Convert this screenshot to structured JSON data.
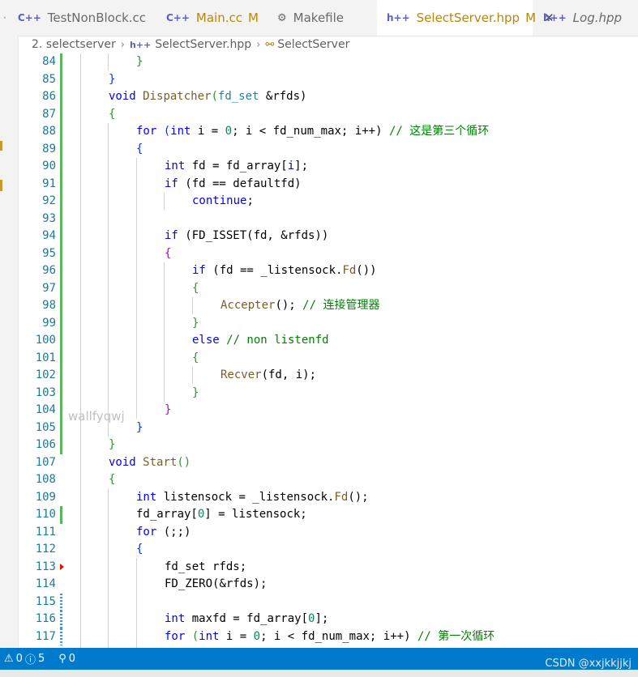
{
  "tabs": [
    {
      "label": "TestNonBlock.cc",
      "icon": "C++",
      "modified": "",
      "active": false
    },
    {
      "label": "Main.cc",
      "icon": "C++",
      "modified": "M",
      "active": false
    },
    {
      "label": "Makefile",
      "icon": "makefile-icon",
      "modified": "",
      "active": false
    },
    {
      "label": "SelectServer.hpp",
      "icon": "h++",
      "modified": "M",
      "active": true,
      "close": "✕"
    },
    {
      "label": "Log.hpp",
      "icon": "h++",
      "modified": "",
      "active": false
    }
  ],
  "breadcrumb": {
    "folder": "2. selectserver",
    "file_icon": "h++",
    "file": "SelectServer.hpp",
    "symbol": "SelectServer"
  },
  "editor": {
    "lines": [
      {
        "n": "84"
      },
      {
        "n": "85"
      },
      {
        "n": "86"
      },
      {
        "n": "87"
      },
      {
        "n": "88"
      },
      {
        "n": "89"
      },
      {
        "n": "90"
      },
      {
        "n": "91"
      },
      {
        "n": "92"
      },
      {
        "n": "93"
      },
      {
        "n": "94"
      },
      {
        "n": "95"
      },
      {
        "n": "96"
      },
      {
        "n": "97"
      },
      {
        "n": "98"
      },
      {
        "n": "99"
      },
      {
        "n": "100"
      },
      {
        "n": "101"
      },
      {
        "n": "102"
      },
      {
        "n": "103"
      },
      {
        "n": "104"
      },
      {
        "n": "105"
      },
      {
        "n": "106"
      },
      {
        "n": "107"
      },
      {
        "n": "108"
      },
      {
        "n": "109"
      },
      {
        "n": "110"
      },
      {
        "n": "111"
      },
      {
        "n": "112"
      },
      {
        "n": "113"
      },
      {
        "n": "114"
      },
      {
        "n": "115"
      },
      {
        "n": "116"
      },
      {
        "n": "117"
      }
    ],
    "code": {
      "l84": "}",
      "l85": "}",
      "l86_kw": "void",
      "l86_fn": "Dispatcher",
      "l86_ty": "fd_set",
      "l86_rest": " &rfds)",
      "l87": "{",
      "l88_kw": "for",
      "l88_ty": "int",
      "l88_a": " i = ",
      "l88_num": "0",
      "l88_b": "; i < fd_num_max; i++) ",
      "l88_cm": "// 这是第三个循环",
      "l89": "{",
      "l90_ty": "int",
      "l90_a": " fd = fd_array[",
      "l90_b": "i",
      "l90_c": "];",
      "l91_kw": "if",
      "l91_a": " (fd == defaultfd)",
      "l92_kw": "continue",
      "l94_kw": "if",
      "l94_a": " (FD_ISSET(fd, &rfds))",
      "l95": "{",
      "l96_kw": "if",
      "l96_a": " (fd == _listensock.",
      "l96_fn": "Fd",
      "l96_b": "())",
      "l97": "{",
      "l98_fn": "Accepter",
      "l98_a": "(); ",
      "l98_cm": "// 连接管理器",
      "l99": "}",
      "l100_kw": "else",
      "l100_cm": " // non listenfd",
      "l101": "{",
      "l102_fn": "Recver",
      "l102_a": "(fd, i);",
      "l103": "}",
      "l104": "}",
      "l105": "}",
      "l106": "}",
      "l107_kw": "void",
      "l107_fn": "Start",
      "l107_a": "()",
      "l108": "{",
      "l109_ty": "int",
      "l109_a": " listensock = _listensock.",
      "l109_fn": "Fd",
      "l109_b": "();",
      "l110_a": "fd_array[",
      "l110_num": "0",
      "l110_b": "] = listensock;",
      "l111_kw": "for",
      "l111_a": " (;;)",
      "l112": "{",
      "l113_ty": "fd_set",
      "l113_a": " rfds;",
      "l114_fn": "FD_ZERO",
      "l114_a": "(&rfds);",
      "l116_ty": "int",
      "l116_a": " maxfd = fd_array[",
      "l116_num": "0",
      "l116_b": "];",
      "l117_kw": "for",
      "l117_ty": "int",
      "l117_a": " i = ",
      "l117_num": "0",
      "l117_b": "; i < fd_num_max; i++) ",
      "l117_cm": "// 第一次循环"
    }
  },
  "watermark": "wallfyqwj",
  "statusbar": {
    "errors": "0",
    "warnings": "5",
    "ports": "0"
  },
  "credit": "CSDN @xxjkkjjkj",
  "colors": {
    "statusbar": "#007acc",
    "line_number": "#237893",
    "keyword": "#0000ff",
    "comment": "#008000",
    "modified_tab": "#b8860b"
  }
}
